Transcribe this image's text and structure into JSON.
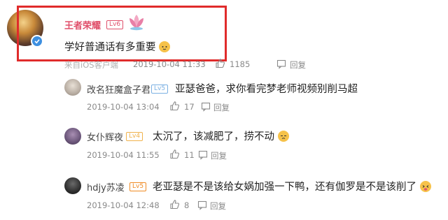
{
  "top_comment": {
    "username": "王者荣耀",
    "level": "Lv6",
    "text": "学好普通话有多重要",
    "source_cut": "来自iOS客户端",
    "time": "2019-10-04 11:33",
    "likes": "1185",
    "reply_label": "回复",
    "colors": {
      "name": "#e0506b",
      "highlight": "#e02b2b"
    }
  },
  "replies": [
    {
      "username": "改名狂魔盒子君",
      "level": "Lv5",
      "level_color": "#7bb0e3",
      "text": "亚瑟爸爸，求你看完梦老师视频别削马超",
      "time": "2019-10-04 13:04",
      "likes": "17",
      "reply_label": "回复"
    },
    {
      "username": "女仆辉夜",
      "level": "Lv4",
      "level_color": "#f0b24b",
      "text": "太沉了，该减肥了，捞不动",
      "time": "2019-10-04 11:55",
      "likes": "11",
      "reply_label": "回复"
    },
    {
      "username": "hdjy苏凌",
      "level": "Lv5",
      "level_color": "#f08b24",
      "text": "老亚瑟是不是该给女娲加强一下鸭，还有伽罗是不是该削了",
      "time": "2019-10-04 12:48",
      "likes": "8",
      "reply_label": "回复"
    }
  ]
}
